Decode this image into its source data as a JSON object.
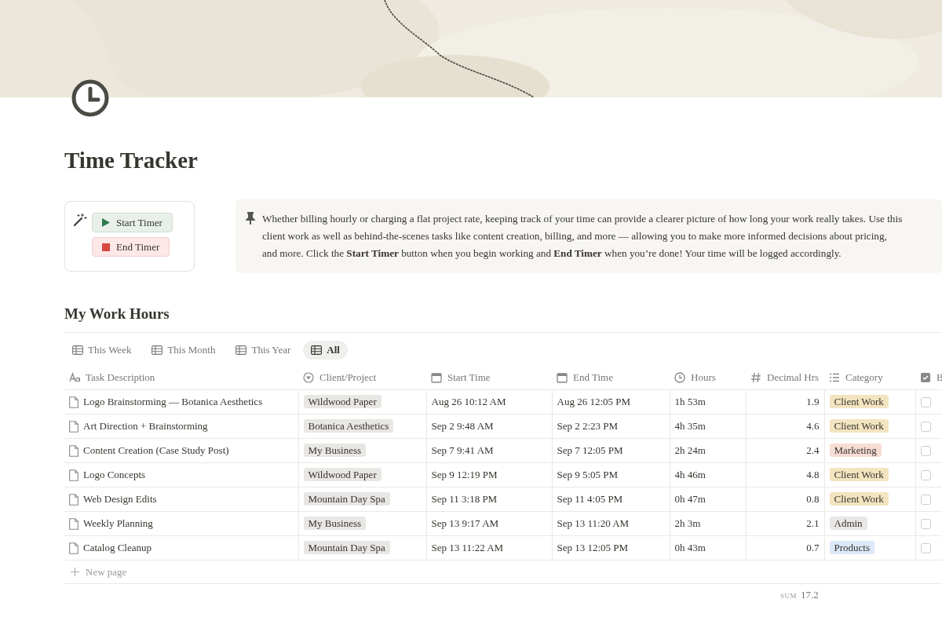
{
  "page": {
    "title": "Time Tracker"
  },
  "buttons": [
    {
      "kind": "start",
      "label": "Start Timer"
    },
    {
      "kind": "end",
      "label": "End Timer"
    }
  ],
  "callout": {
    "lines": [
      "Whether billing hourly or charging a flat project rate, keeping track of your time can provide a clearer picture of how long your work really takes. Use this",
      "client work as well as behind-the-scenes tasks like content creation, billing, and more — allowing you to make more informed decisions about pricing,",
      "and more. Click the **Start Timer** button when you begin working and **End Timer** when you’re done! Your time will be logged accordingly."
    ]
  },
  "database": {
    "title": "My Work Hours",
    "views": [
      {
        "label": "This Week",
        "selected": false
      },
      {
        "label": "This Month",
        "selected": false
      },
      {
        "label": "This Year",
        "selected": false
      },
      {
        "label": "All",
        "selected": true
      }
    ],
    "columns": [
      {
        "kind": "title",
        "label": "Task Description"
      },
      {
        "kind": "select",
        "label": "Client/Project"
      },
      {
        "kind": "date",
        "label": "Start Time"
      },
      {
        "kind": "date",
        "label": "End Time"
      },
      {
        "kind": "clock",
        "label": "Hours"
      },
      {
        "kind": "number",
        "label": "Decimal Hrs"
      },
      {
        "kind": "multi",
        "label": "Category"
      },
      {
        "kind": "checkbox",
        "label": "B"
      }
    ],
    "rows": [
      {
        "task": "Logo Brainstorming — Botanica Aesthetics",
        "client": "Wildwood Paper",
        "start": "Aug 26 10:12 AM",
        "end": "Aug 26 12:05 PM",
        "hours": "1h 53m",
        "decimal": "1.9",
        "category": {
          "label": "Client Work",
          "color": "#f3e4c0"
        },
        "checked": false
      },
      {
        "task": "Art Direction + Brainstorming",
        "client": "Botanica Aesthetics",
        "start": "Sep 2 9:48 AM",
        "end": "Sep 2 2:23 PM",
        "hours": "4h 35m",
        "decimal": "4.6",
        "category": {
          "label": "Client Work",
          "color": "#f3e4c0"
        },
        "checked": false
      },
      {
        "task": "Content Creation (Case Study Post)",
        "client": "My Business",
        "start": "Sep 7 9:41 AM",
        "end": "Sep 7 12:05 PM",
        "hours": "2h 24m",
        "decimal": "2.4",
        "category": {
          "label": "Marketing",
          "color": "#f6ddd4"
        },
        "checked": false
      },
      {
        "task": "Logo Concepts",
        "client": "Wildwood Paper",
        "start": "Sep 9 12:19 PM",
        "end": "Sep 9 5:05 PM",
        "hours": "4h 46m",
        "decimal": "4.8",
        "category": {
          "label": "Client Work",
          "color": "#f3e4c0"
        },
        "checked": false
      },
      {
        "task": "Web Design Edits",
        "client": "Mountain Day Spa",
        "start": "Sep 11 3:18 PM",
        "end": "Sep 11 4:05 PM",
        "hours": "0h 47m",
        "decimal": "0.8",
        "category": {
          "label": "Client Work",
          "color": "#f3e4c0"
        },
        "checked": false
      },
      {
        "task": "Weekly Planning",
        "client": "My Business",
        "start": "Sep 13 9:17 AM",
        "end": "Sep 13 11:20 AM",
        "hours": "2h 3m",
        "decimal": "2.1",
        "category": {
          "label": "Admin",
          "color": "#e9e7e4"
        },
        "checked": false
      },
      {
        "task": "Catalog Cleanup",
        "client": "Mountain Day Spa",
        "start": "Sep 13 11:22 AM",
        "end": "Sep 13 12:05 PM",
        "hours": "0h 43m",
        "decimal": "0.7",
        "category": {
          "label": "Products",
          "color": "#dbe8f7"
        },
        "checked": false
      }
    ],
    "new_page": "New page",
    "sum": {
      "label": "SUM",
      "value": "17.2"
    }
  }
}
